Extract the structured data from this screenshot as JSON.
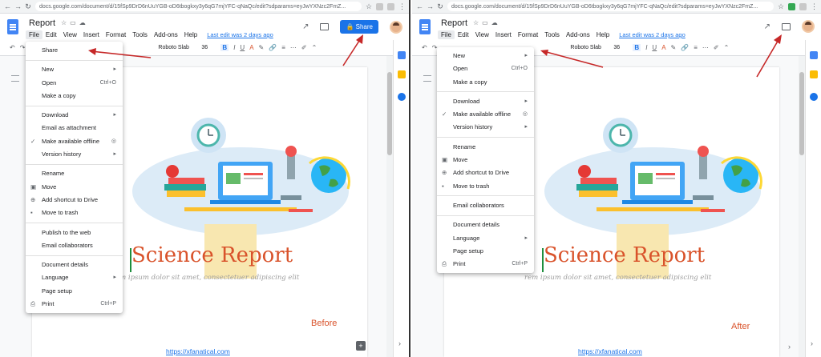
{
  "colors": {
    "accent": "#1a73e8",
    "annotation": "#c62828",
    "title": "#d9532b"
  },
  "before": {
    "url": "docs.google.com/document/d/15fSp9DrD6nUuYGB-oD6tbogkxy3y6qG7mjYFC-qNaQc/edit?sdparams=eyJwYXNzc2FmZ...",
    "doc_title": "Report",
    "menus": [
      "File",
      "Edit",
      "View",
      "Insert",
      "Format",
      "Tools",
      "Add-ons",
      "Help"
    ],
    "last_edit": "Last edit was 2 days ago",
    "share_label": "Share",
    "font": "Roboto Slab",
    "font_size": "36",
    "doc_heading": "Science Report",
    "doc_subtitle": "rem ipsum dolor sit amet, consectetuer adipiscing elit",
    "link": "https://xfanatical.com",
    "caption": "Before",
    "file_menu": [
      {
        "label": "Share"
      },
      {
        "sep": true
      },
      {
        "label": "New",
        "arrow": true
      },
      {
        "label": "Open",
        "shortcut": "Ctrl+O"
      },
      {
        "label": "Make a copy"
      },
      {
        "sep": true
      },
      {
        "label": "Download",
        "arrow": true
      },
      {
        "label": "Email as attachment"
      },
      {
        "label": "Make available offline",
        "check": true
      },
      {
        "label": "Version history",
        "arrow": true
      },
      {
        "sep": true
      },
      {
        "label": "Rename"
      },
      {
        "label": "Move",
        "icon": "move-icon"
      },
      {
        "label": "Add shortcut to Drive",
        "icon": "drive-shortcut-icon"
      },
      {
        "label": "Move to trash",
        "icon": "trash-icon"
      },
      {
        "sep": true
      },
      {
        "label": "Publish to the web"
      },
      {
        "label": "Email collaborators"
      },
      {
        "sep": true
      },
      {
        "label": "Document details"
      },
      {
        "label": "Language",
        "arrow": true
      },
      {
        "label": "Page setup"
      },
      {
        "label": "Print",
        "shortcut": "Ctrl+P",
        "icon": "print-icon"
      }
    ]
  },
  "after": {
    "url": "docs.google.com/document/d/15fSp9DrD6nUuYGB-oD6tbogkxy3y6qG7mjYFC-qNaQc/edit?sdparams=eyJwYXNzc2FmZ...",
    "doc_title": "Report",
    "menus": [
      "File",
      "Edit",
      "View",
      "Insert",
      "Format",
      "Tools",
      "Add-ons",
      "Help"
    ],
    "last_edit": "Last edit was 2 days ago",
    "font": "Roboto Slab",
    "font_size": "36",
    "doc_heading": "Science Report",
    "doc_subtitle": "rem ipsum dolor sit amet, consectetuer adipiscing elit",
    "link": "https://xfanatical.com",
    "caption": "After",
    "file_menu": [
      {
        "label": "New",
        "arrow": true
      },
      {
        "label": "Open",
        "shortcut": "Ctrl+O"
      },
      {
        "label": "Make a copy"
      },
      {
        "sep": true
      },
      {
        "label": "Download",
        "arrow": true
      },
      {
        "label": "Make available offline",
        "check": true
      },
      {
        "label": "Version history",
        "arrow": true
      },
      {
        "sep": true
      },
      {
        "label": "Rename"
      },
      {
        "label": "Move",
        "icon": "move-icon"
      },
      {
        "label": "Add shortcut to Drive",
        "icon": "drive-shortcut-icon"
      },
      {
        "label": "Move to trash",
        "icon": "trash-icon"
      },
      {
        "sep": true
      },
      {
        "label": "Email collaborators"
      },
      {
        "sep": true
      },
      {
        "label": "Document details"
      },
      {
        "label": "Language",
        "arrow": true
      },
      {
        "label": "Page setup"
      },
      {
        "label": "Print",
        "shortcut": "Ctrl+P",
        "icon": "print-icon"
      }
    ]
  }
}
